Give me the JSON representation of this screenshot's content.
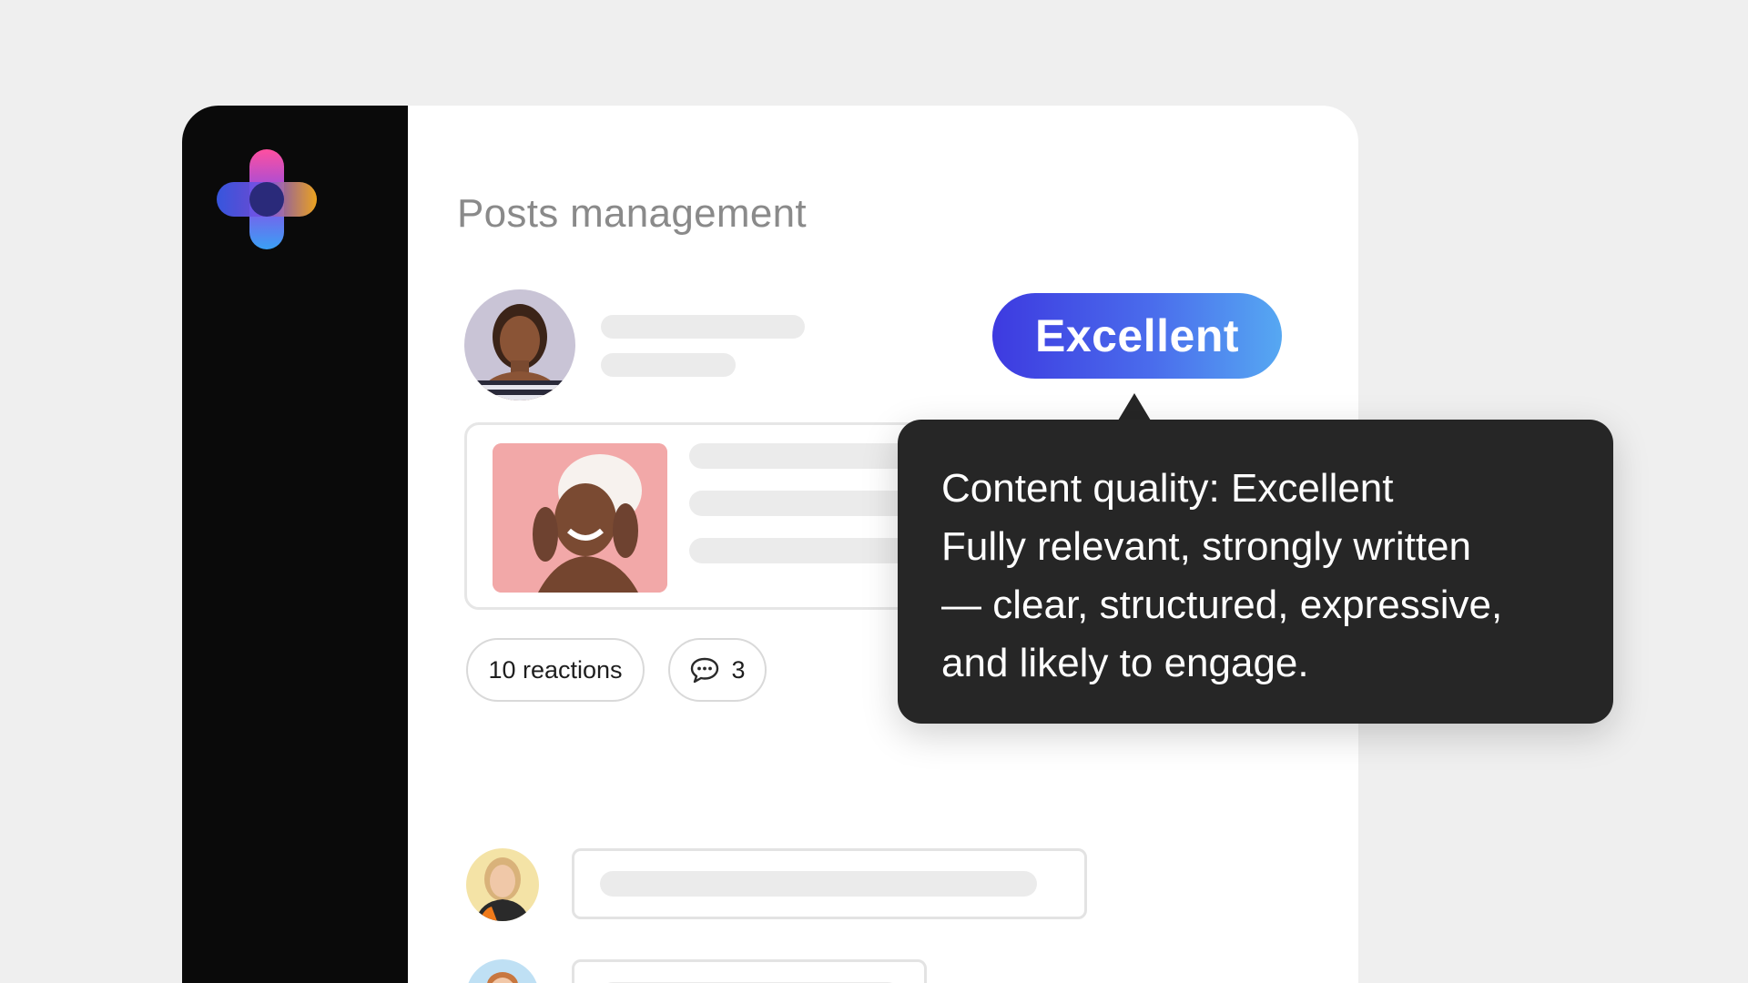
{
  "page": {
    "title": "Posts management"
  },
  "quality_badge": {
    "label": "Excellent"
  },
  "post": {
    "reactions_label": "10 reactions",
    "comments_count": "3"
  },
  "tooltip": {
    "lines": [
      "Content quality: Excellent",
      "Fully relevant, strongly written",
      "— clear, structured, expressive,",
      "and likely to engage."
    ]
  },
  "icons": {
    "logo": "app-logo-icon",
    "comment": "comment-bubble-icon"
  },
  "colors": {
    "sidebar": "#0a0a0a",
    "badge_gradient_start": "#3d3ae0",
    "badge_gradient_end": "#56a8f2",
    "tooltip_bg": "#262626"
  }
}
